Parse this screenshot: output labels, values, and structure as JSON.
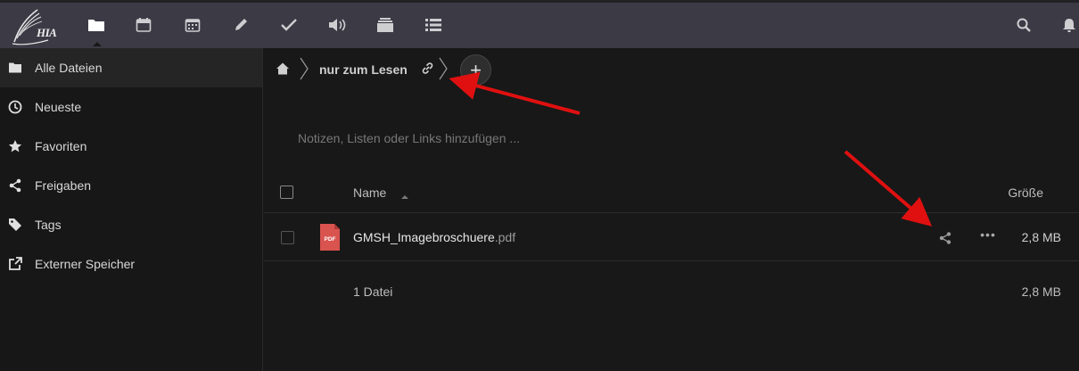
{
  "topbar": {
    "logo_text": "HIA",
    "apps": [
      {
        "name": "files",
        "active": true
      },
      {
        "name": "calendar"
      },
      {
        "name": "calendar-grid"
      },
      {
        "name": "notes"
      },
      {
        "name": "tasks"
      },
      {
        "name": "audio"
      },
      {
        "name": "deck"
      },
      {
        "name": "list"
      }
    ]
  },
  "sidebar": {
    "items": [
      {
        "label": "Alle Dateien",
        "icon": "folder-icon",
        "active": true
      },
      {
        "label": "Neueste",
        "icon": "clock-icon"
      },
      {
        "label": "Favoriten",
        "icon": "star-icon"
      },
      {
        "label": "Freigaben",
        "icon": "share-icon"
      },
      {
        "label": "Tags",
        "icon": "tag-icon"
      },
      {
        "label": "Externer Speicher",
        "icon": "external-link-icon"
      }
    ]
  },
  "breadcrumb": {
    "folder_label": "nur zum Lesen",
    "add_label": "+"
  },
  "notes": {
    "placeholder": "Notizen, Listen oder Links hinzufügen ..."
  },
  "table": {
    "col_name": "Name",
    "col_size": "Größe",
    "files": [
      {
        "name": "GMSH_Imagebroschuere",
        "ext": ".pdf",
        "type_label": "PDF",
        "size": "2,8 MB"
      }
    ],
    "summary_count": "1 Datei",
    "summary_size": "2,8 MB"
  },
  "colors": {
    "topbar": "#3c3a45",
    "background": "#181818",
    "pdf_red": "#d9534f",
    "annotation_arrow": "#e01010"
  }
}
